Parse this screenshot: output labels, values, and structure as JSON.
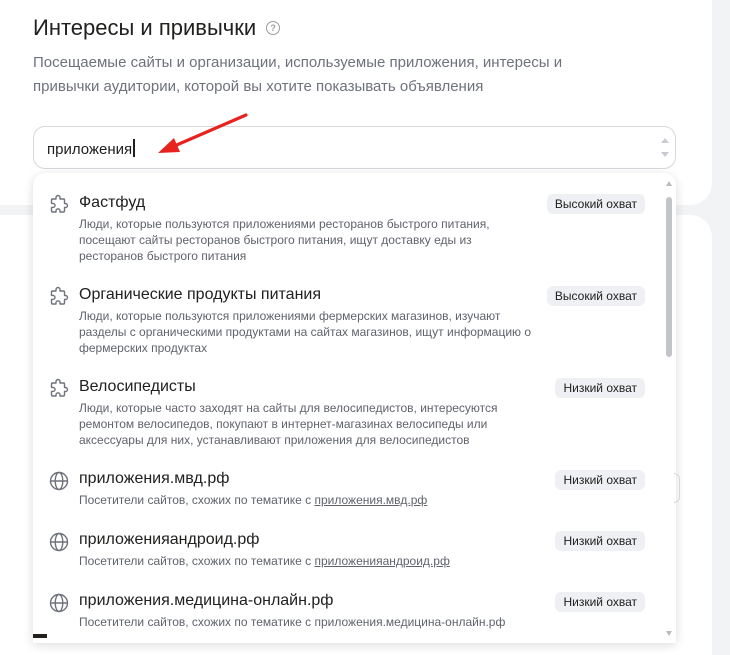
{
  "section": {
    "title": "Интересы и привычки",
    "help_icon": "question-circle-icon",
    "description": "Посещаемые сайты и организации, используемые приложения, интересы и привычки аудитории, которой вы хотите показывать объявления"
  },
  "search": {
    "value": "приложения"
  },
  "annotation": {
    "arrow_color": "#e8221f"
  },
  "dropdown": {
    "items": [
      {
        "icon": "puzzle-icon",
        "title": "Фастфуд",
        "description": "Люди, которые пользуются приложениями ресторанов быстрого питания, посещают сайты ресторанов быстрого питания, ищут доставку еды из ресторанов быстрого питания",
        "badge": "Высокий охват"
      },
      {
        "icon": "puzzle-icon",
        "title": "Органические продукты питания",
        "description": "Люди, которые пользуются приложениями фермерских магазинов, изучают разделы с органическими продуктами на сайтах магазинов, ищут информацию о фермерских продуктах",
        "badge": "Высокий охват"
      },
      {
        "icon": "puzzle-icon",
        "title": "Велосипедисты",
        "description": "Люди, которые часто заходят на сайты для велосипедистов, интересуются ремонтом велосипедов, покупают в интернет-магазинах велосипеды или аксессуары для них, устанавливают приложения для велосипедистов",
        "badge": "Низкий охват"
      },
      {
        "icon": "globe-icon",
        "title": "приложения.мвд.рф",
        "description_prefix": "Посетители сайтов, схожих по тематике с ",
        "description_link": "приложения.мвд.рф",
        "badge": "Низкий охват"
      },
      {
        "icon": "globe-icon",
        "title": "приложенияандроид.рф",
        "description_prefix": "Посетители сайтов, схожих по тематике с ",
        "description_link": "приложенияандроид.рф",
        "badge": "Низкий охват"
      },
      {
        "icon": "globe-icon",
        "title": "приложения.медицина-онлайн.рф",
        "description_prefix": "Посетители сайтов, схожих по тематике с ",
        "description_link": "приложения.медицина-онлайн.рф",
        "badge": "Низкий охват"
      }
    ]
  }
}
